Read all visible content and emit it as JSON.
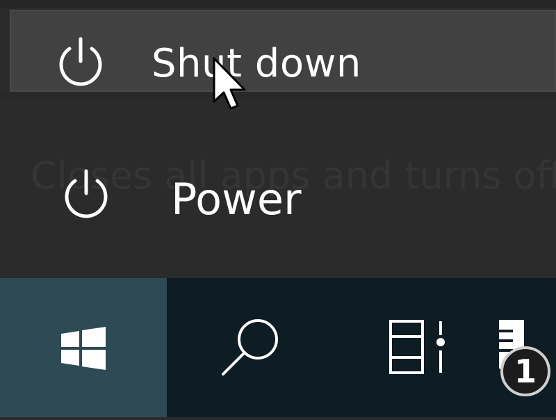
{
  "power_menu": {
    "shutdown_label": "Shut down",
    "tooltip_text": "Closes all apps and turns off",
    "power_label": "Power"
  },
  "taskbar": {
    "notification_count": "1"
  },
  "icons": {
    "shutdown": "power-icon",
    "power": "power-icon",
    "start": "windows-logo-icon",
    "search": "search-icon",
    "task_view": "task-view-icon",
    "app": "app-icon",
    "cursor": "mouse-cursor-icon"
  },
  "colors": {
    "menu_bg": "#2b2b2b",
    "hover_bg": "#414141",
    "taskbar_bg": "#0e1c24",
    "start_bg": "#2e4a55",
    "text": "#ffffff"
  }
}
